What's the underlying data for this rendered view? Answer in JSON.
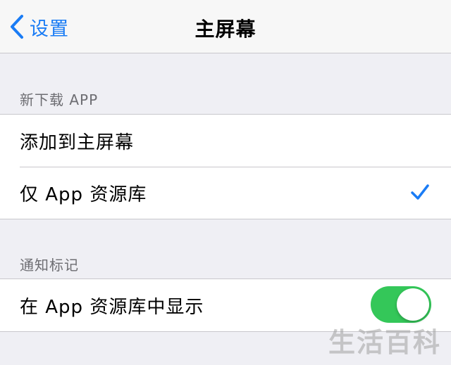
{
  "navbar": {
    "back_label": "设置",
    "title": "主屏幕"
  },
  "sections": [
    {
      "header": "新下载 APP",
      "rows": [
        {
          "label": "添加到主屏幕",
          "selected": false
        },
        {
          "label": "仅 App 资源库",
          "selected": true
        }
      ]
    },
    {
      "header": "通知标记",
      "rows": [
        {
          "label": "在 App 资源库中显示",
          "toggle_on": true
        }
      ]
    }
  ],
  "watermark": "生活百科",
  "colors": {
    "accent": "#1a7cf5",
    "toggle_on": "#34c759",
    "background": "#efeff4"
  }
}
